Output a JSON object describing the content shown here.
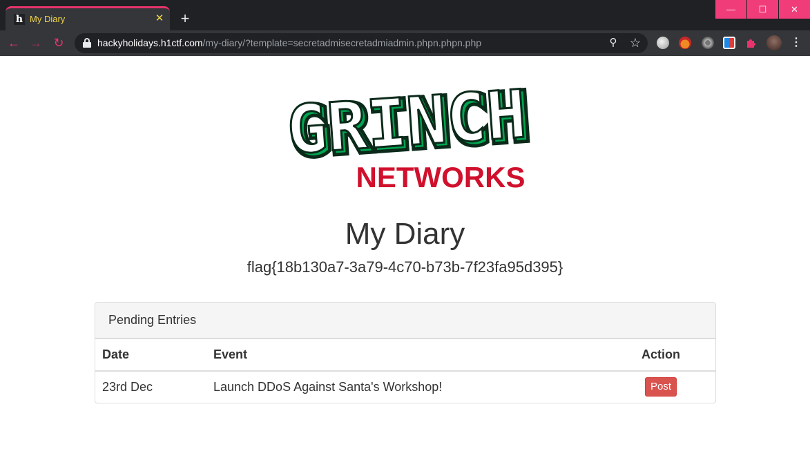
{
  "browser": {
    "tab": {
      "title": "My Diary",
      "favicon": "h",
      "close": "✕"
    },
    "new_tab": "+",
    "window_controls": {
      "minimize": "—",
      "maximize": "☐",
      "close": "✕"
    },
    "url_host": "hackyholidays.h1ctf.com",
    "url_path": "/my-diary/?template=secretadmisecretadmiadmin.phpn.phpn.php",
    "icons": {
      "back": "←",
      "forward": "→",
      "reload": "↻",
      "zoom": "⚲",
      "star": "☆",
      "menu": "⋮"
    },
    "accent_color": "#e8336c"
  },
  "page": {
    "logo": {
      "top_text": "GRINCH",
      "bottom_text": "NETWORKS",
      "colors": {
        "green": "#00a651",
        "red": "#d0102c",
        "dark": "#0b2a1a"
      }
    },
    "heading": "My Diary",
    "flag": "flag{18b130a7-3a79-4c70-b73b-7f23fa95d395}",
    "panel": {
      "title": "Pending Entries",
      "columns": [
        "Date",
        "Event",
        "Action"
      ],
      "rows": [
        {
          "date": "23rd Dec",
          "event": "Launch DDoS Against Santa's Workshop!",
          "action": "Post"
        }
      ]
    }
  }
}
